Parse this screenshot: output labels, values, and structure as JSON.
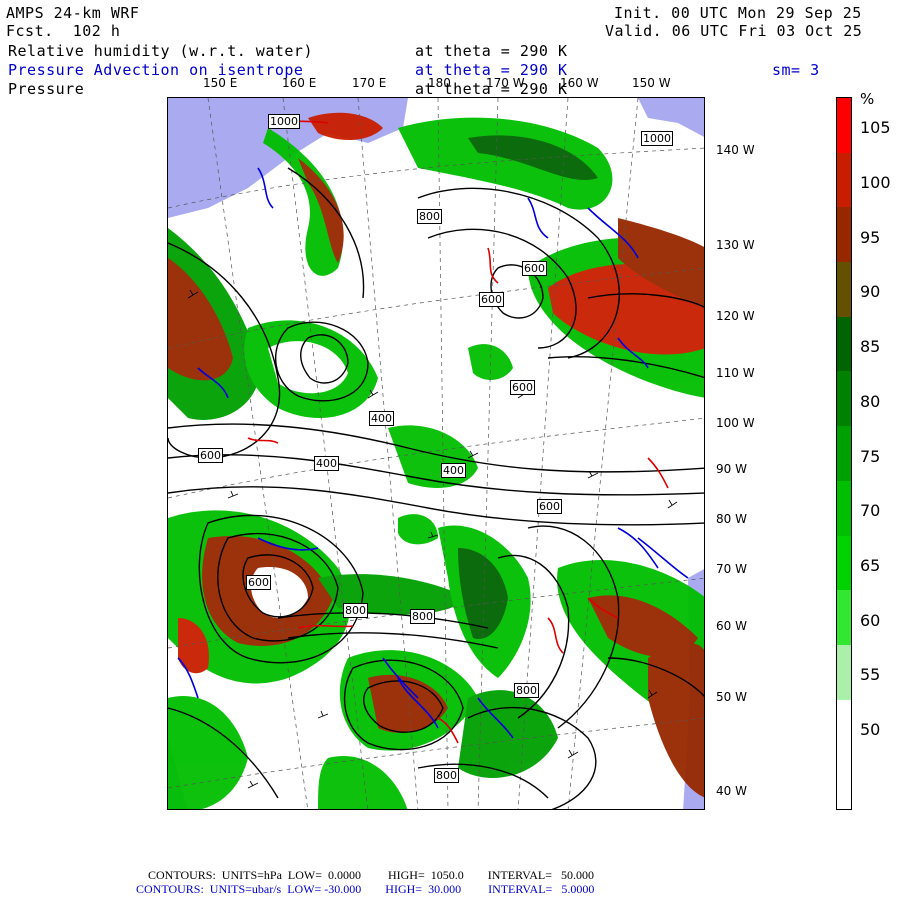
{
  "header": {
    "model": "AMPS 24-km WRF",
    "fcst": "Fcst.  102 h",
    "init": "Init. 00 UTC Mon 29 Sep 25",
    "valid": "Valid. 06 UTC Fri 03 Oct 25",
    "field1": "Relative humidity (w.r.t. water)",
    "field1_level": "at theta = 290 K",
    "field2": "Pressure Advection on isentrope",
    "field2_level": "at theta = 290 K",
    "smoothing": "sm= 3",
    "field3": "Pressure",
    "field3_level": "at theta = 290 K"
  },
  "lon_labels_top": [
    "150 E",
    "160 E",
    "170 E",
    "180",
    "170 W",
    "160 W",
    "150 W"
  ],
  "lat_labels_right": [
    "140 W",
    "130 W",
    "120 W",
    "110 W",
    "100 W",
    "90 W",
    "80 W",
    "70 W",
    "60 W",
    "50 W",
    "40 W"
  ],
  "contour_labels": [
    "1000",
    "1000",
    "800",
    "600",
    "600",
    "600",
    "400",
    "600",
    "400",
    "600",
    "400",
    "600",
    "800",
    "800",
    "800",
    "800"
  ],
  "colorbar": {
    "unit": "%",
    "labels": [
      "105",
      "100",
      "95",
      "90",
      "85",
      "80",
      "75",
      "70",
      "65",
      "60",
      "55",
      "50"
    ],
    "colors": [
      "#ff0000",
      "#c81e00",
      "#962800",
      "#645000",
      "#006400",
      "#008200",
      "#00a000",
      "#00be00",
      "#00d200",
      "#32e632",
      "#aaf0aa",
      "#ffffff",
      "#ffffff"
    ]
  },
  "footer": {
    "line1": "CONTOURS:  UNITS=hPa  LOW=  0.0000         HIGH=  1050.0        INTERVAL=   50.000",
    "line2": "CONTOURS:  UNITS=ubar/s  LOW= -30.000        HIGH=  30.000         INTERVAL=   5.0000"
  }
}
